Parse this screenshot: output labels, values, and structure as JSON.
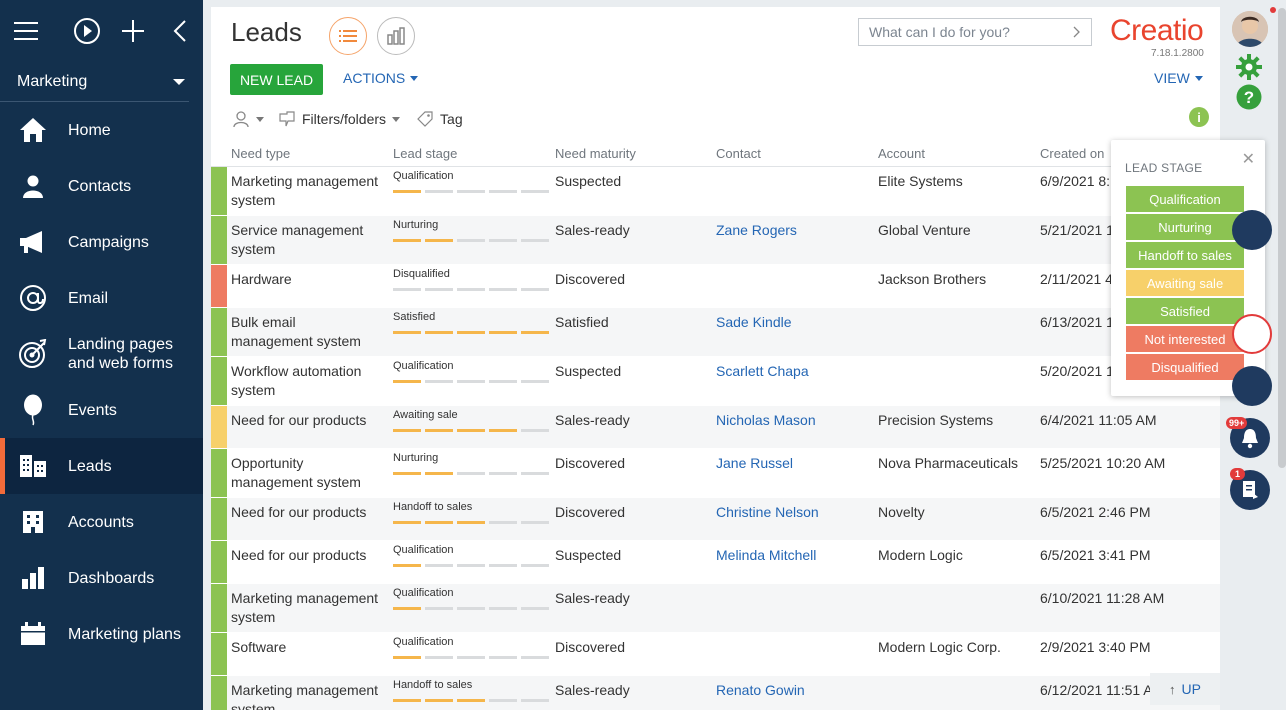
{
  "sidebar": {
    "workspace": "Marketing",
    "items": [
      {
        "label": "Home",
        "icon": "home-icon"
      },
      {
        "label": "Contacts",
        "icon": "person-icon"
      },
      {
        "label": "Campaigns",
        "icon": "megaphone-icon"
      },
      {
        "label": "Email",
        "icon": "at-icon"
      },
      {
        "label": "Landing pages",
        "label2": "and web forms",
        "icon": "target-icon"
      },
      {
        "label": "Events",
        "icon": "balloon-icon"
      },
      {
        "label": "Leads",
        "icon": "leads-icon",
        "active": true
      },
      {
        "label": "Accounts",
        "icon": "building-icon"
      },
      {
        "label": "Dashboards",
        "icon": "bar-chart-icon"
      },
      {
        "label": "Marketing plans",
        "icon": "calendar-icon"
      }
    ]
  },
  "header": {
    "title": "Leads",
    "search_placeholder": "What can I do for you?",
    "logo": "Creatio",
    "version": "7.18.1.2800",
    "new_lead": "NEW LEAD",
    "actions": "ACTIONS",
    "view": "VIEW",
    "filters": "Filters/folders",
    "tag": "Tag",
    "info": "i"
  },
  "columns": {
    "need": "Need type",
    "stage": "Lead stage",
    "maturity": "Need maturity",
    "contact": "Contact",
    "account": "Account",
    "created": "Created on"
  },
  "rows": [
    {
      "need": "Marketing management system",
      "stage": "Qualification",
      "filled": 1,
      "maturity": "Suspected",
      "contact": "",
      "account": "Elite Systems",
      "created": "6/9/2021 8:1",
      "color": "#8cc352",
      "h": 49
    },
    {
      "need": "Service management system",
      "stage": "Nurturing",
      "filled": 2,
      "maturity": "Sales-ready",
      "contact": "Zane Rogers",
      "account": "Global Venture",
      "created": "5/21/2021 1",
      "color": "#8cc352",
      "h": 49
    },
    {
      "need": "Hardware",
      "stage": "Disqualified",
      "filled": 0,
      "maturity": "Discovered",
      "contact": "",
      "account": "Jackson Brothers",
      "created": "2/11/2021 4",
      "color": "#ee7b62",
      "h": 43
    },
    {
      "need": "Bulk email management system",
      "stage": "Satisfied",
      "filled": 5,
      "maturity": "Satisfied",
      "contact": "Sade Kindle",
      "account": "",
      "created": "6/13/2021 1",
      "color": "#8cc352",
      "h": 49
    },
    {
      "need": "Workflow automation system",
      "stage": "Qualification",
      "filled": 1,
      "maturity": "Suspected",
      "contact": "Scarlett Chapa",
      "account": "",
      "created": "5/20/2021 1",
      "color": "#8cc352",
      "h": 49
    },
    {
      "need": "Need for our products",
      "stage": "Awaiting sale",
      "filled": 4,
      "maturity": "Sales-ready",
      "contact": "Nicholas Mason",
      "account": "Precision Systems",
      "created": "6/4/2021 11:05 AM",
      "color": "#f7d06a",
      "h": 43
    },
    {
      "need": "Opportunity management system",
      "stage": "Nurturing",
      "filled": 2,
      "maturity": "Discovered",
      "contact": "Jane Russel",
      "account": "Nova Pharmaceuticals",
      "created": "5/25/2021 10:20 AM",
      "color": "#8cc352",
      "h": 49
    },
    {
      "need": "Need for our products",
      "stage": "Handoff to sales",
      "filled": 3,
      "maturity": "Discovered",
      "contact": "Christine Nelson",
      "account": "Novelty",
      "created": "6/5/2021 2:46 PM",
      "color": "#8cc352",
      "h": 43
    },
    {
      "need": "Need for our products",
      "stage": "Qualification",
      "filled": 1,
      "maturity": "Suspected",
      "contact": "Melinda Mitchell",
      "account": "Modern Logic",
      "created": "6/5/2021 3:41 PM",
      "color": "#8cc352",
      "h": 43
    },
    {
      "need": "Marketing management system",
      "stage": "Qualification",
      "filled": 1,
      "maturity": "Sales-ready",
      "contact": "",
      "account": "",
      "created": "6/10/2021 11:28 AM",
      "color": "#8cc352",
      "h": 49
    },
    {
      "need": "Software",
      "stage": "Qualification",
      "filled": 1,
      "maturity": "Discovered",
      "contact": "",
      "account": "Modern Logic Corp.",
      "created": "2/9/2021 3:40 PM",
      "color": "#8cc352",
      "h": 43
    },
    {
      "need": "Marketing management system",
      "stage": "Handoff to sales",
      "filled": 3,
      "maturity": "Sales-ready",
      "contact": "Renato Gowin",
      "account": "",
      "created": "6/12/2021 11:51 A",
      "color": "#8cc352",
      "h": 49
    }
  ],
  "legend": {
    "title": "LEAD STAGE",
    "items": [
      {
        "label": "Qualification",
        "color": "#8cc352"
      },
      {
        "label": "Nurturing",
        "color": "#8cc352"
      },
      {
        "label": "Handoff to sales",
        "color": "#8cc352"
      },
      {
        "label": "Awaiting sale",
        "color": "#f7d06a"
      },
      {
        "label": "Satisfied",
        "color": "#8cc352"
      },
      {
        "label": "Not interested",
        "color": "#ee7b62"
      },
      {
        "label": "Disqualified",
        "color": "#ee7b62"
      }
    ]
  },
  "rightbar": {
    "notifications_badge": "99+",
    "feed_badge": "1"
  },
  "up_label": "UP"
}
